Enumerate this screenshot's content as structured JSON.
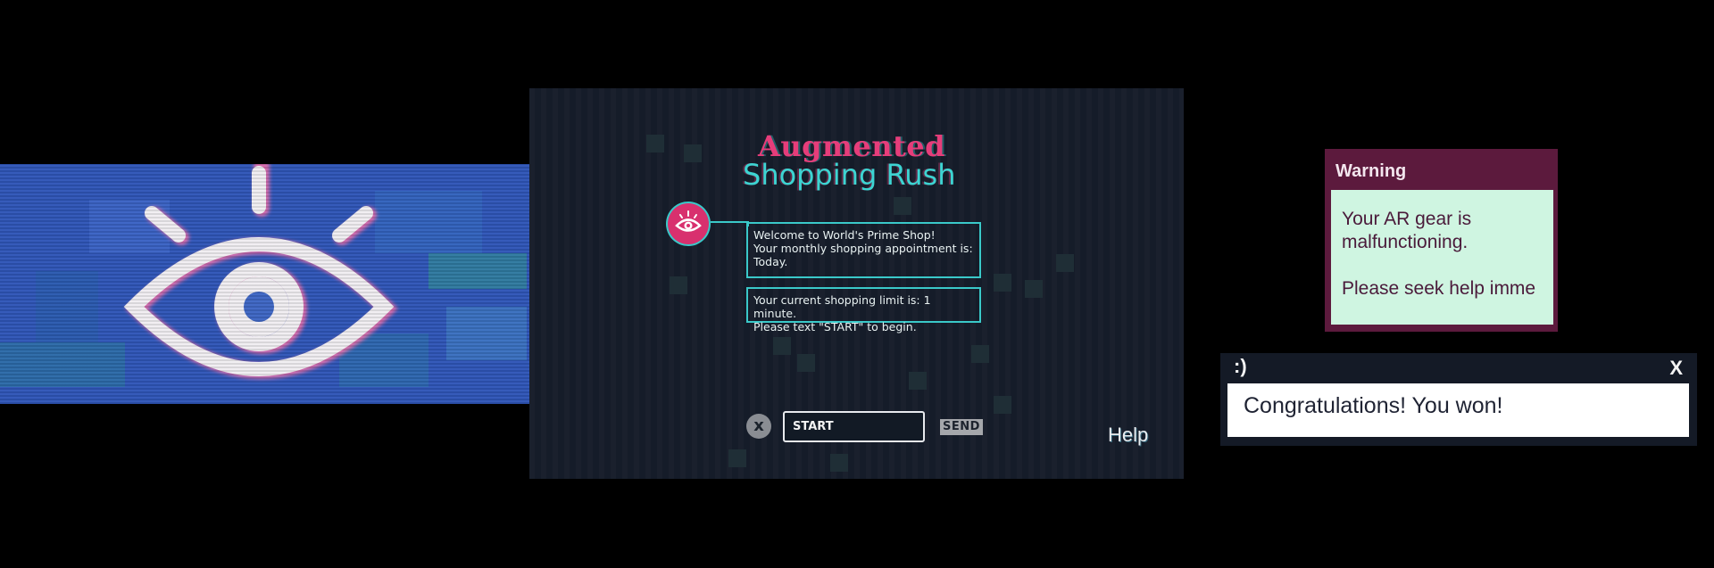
{
  "game": {
    "title_line1": "Augmented",
    "title_line2": "Shopping Rush",
    "messages": [
      {
        "lines": [
          "Welcome to World's Prime Shop!",
          "Your monthly shopping appointment is:",
          "Today."
        ]
      },
      {
        "lines": [
          "Your current shopping limit is: 1 minute.",
          "Please text \"START\" to begin."
        ]
      }
    ],
    "clear_label": "x",
    "input_value": "START",
    "send_label": "SEND",
    "help_label": "Help"
  },
  "warning": {
    "title": "Warning",
    "line1": "Your AR gear is",
    "line2": "malfunctioning.",
    "line3": "Please seek help imme"
  },
  "congrats": {
    "title": ":)",
    "close_label": "X",
    "message": "Congratulations! You won!"
  },
  "colors": {
    "eye_banner_bg": "#2f56b8",
    "game_bg": "#151c29",
    "title_pink": "#e63d7a",
    "title_cyan": "#3dd4d2",
    "warning_frame": "#5c1a3d",
    "warning_body": "#cff5e1"
  },
  "icons": {
    "banner": "eye-icon",
    "avatar": "eye-icon",
    "clear": "close-icon"
  }
}
